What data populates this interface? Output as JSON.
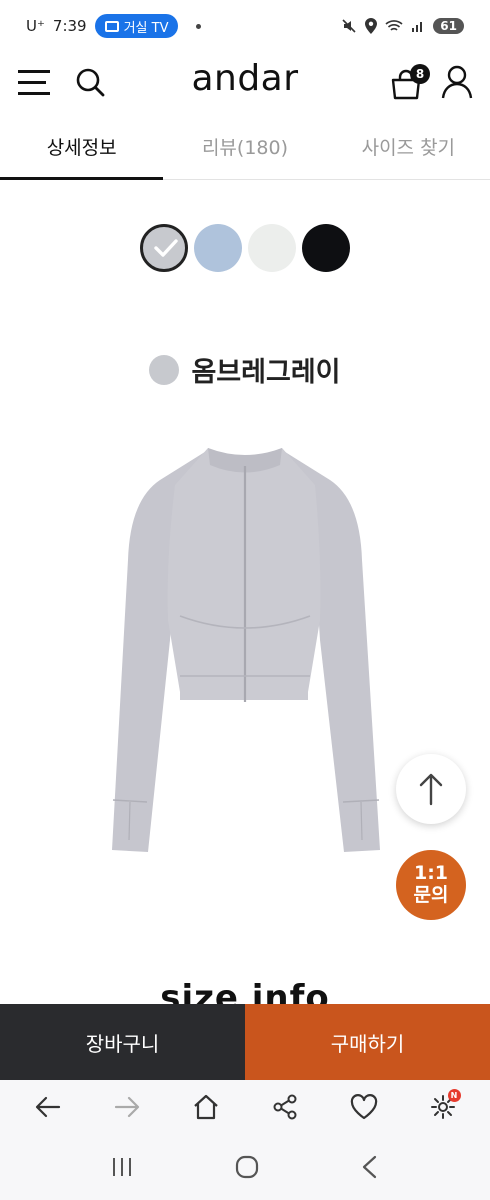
{
  "status": {
    "carrier": "U⁺",
    "time": "7:39",
    "cast_label": "거실 TV",
    "battery": "61"
  },
  "header": {
    "logo": "andar",
    "cart_count": "8"
  },
  "tabs": [
    {
      "label": "상세정보",
      "active": true
    },
    {
      "label": "리뷰(180)",
      "active": false
    },
    {
      "label": "사이즈 찾기",
      "active": false
    }
  ],
  "swatches": [
    {
      "color": "#c7c9ce",
      "selected": true
    },
    {
      "color": "#afc3dc",
      "selected": false
    },
    {
      "color": "#eceeec",
      "selected": false
    },
    {
      "color": "#0e0f12",
      "selected": false
    }
  ],
  "selected_color": {
    "name": "옴브레그레이",
    "hex": "#c7c9ce"
  },
  "floating": {
    "inquiry_line1": "1:1",
    "inquiry_line2": "문의"
  },
  "section_heading": "size info",
  "buy_bar": {
    "cart_label": "장바구니",
    "buy_label": "구매하기"
  },
  "colors": {
    "buy_accent": "#c9551d",
    "cart_dark": "#2a2b2e",
    "inquiry_accent": "#d4631f"
  }
}
